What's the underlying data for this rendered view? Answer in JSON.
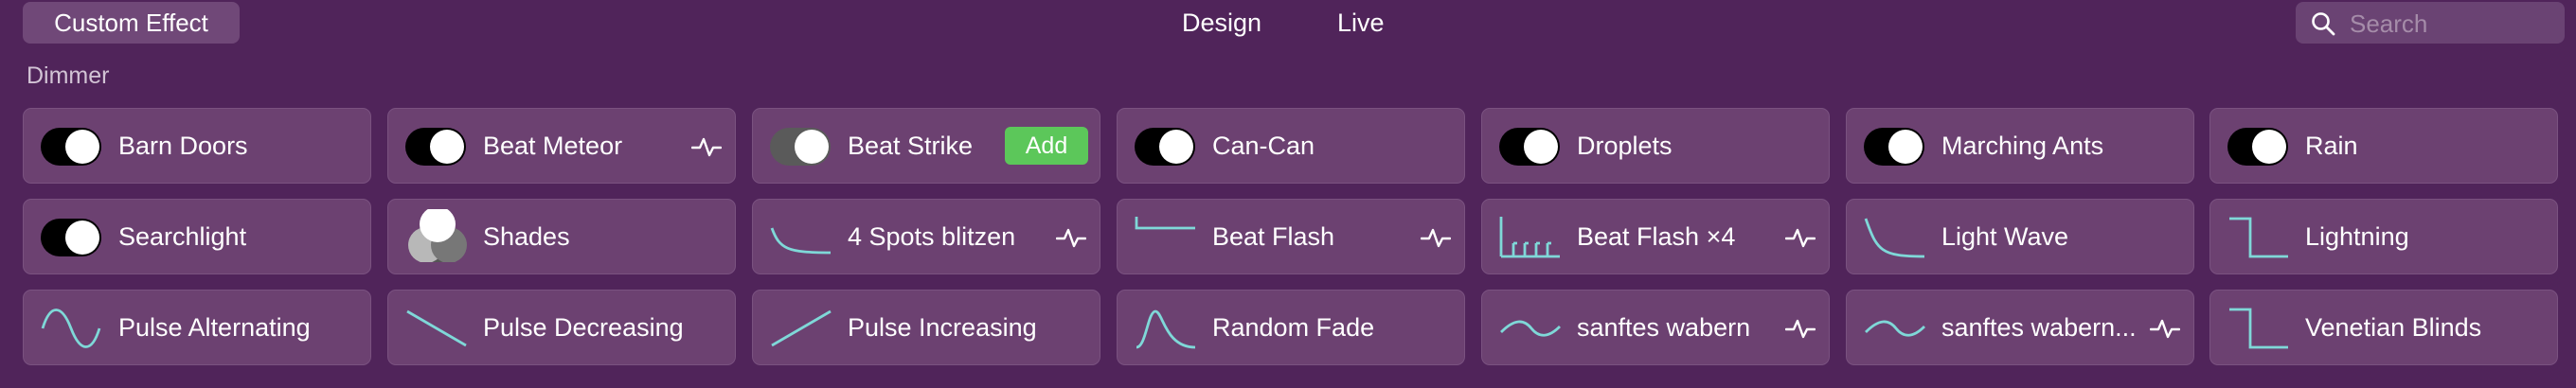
{
  "toolbar": {
    "custom_effect_label": "Custom Effect",
    "design_label": "Design",
    "live_label": "Live",
    "search_placeholder": "Search"
  },
  "section": {
    "title": "Dimmer"
  },
  "accent_color": "#7fd8d8",
  "add_button_color": "#5cc75a",
  "cards": [
    {
      "label": "Barn Doors",
      "icon": "toggle-icon",
      "pulse": false
    },
    {
      "label": "Beat Meteor",
      "icon": "toggle-icon",
      "pulse": true
    },
    {
      "label": "Beat Strike",
      "icon": "toggle-dim-icon",
      "pulse": false,
      "add_label": "Add"
    },
    {
      "label": "Can-Can",
      "icon": "toggle-icon",
      "pulse": false
    },
    {
      "label": "Droplets",
      "icon": "toggle-icon",
      "pulse": false
    },
    {
      "label": "Marching Ants",
      "icon": "toggle-icon",
      "pulse": false
    },
    {
      "label": "Rain",
      "icon": "toggle-icon",
      "pulse": false
    },
    {
      "label": "Searchlight",
      "icon": "toggle-icon",
      "pulse": false
    },
    {
      "label": "Shades",
      "icon": "shades-icon",
      "pulse": false
    },
    {
      "label": "4 Spots blitzen",
      "icon": "decay-curve-icon",
      "pulse": true
    },
    {
      "label": "Beat Flash",
      "icon": "flash-step-icon",
      "pulse": true
    },
    {
      "label": "Beat Flash ×4",
      "icon": "flash-bars-icon",
      "pulse": true
    },
    {
      "label": "Light Wave",
      "icon": "light-wave-icon",
      "pulse": false
    },
    {
      "label": "Lightning",
      "icon": "step-down-icon",
      "pulse": false
    },
    {
      "label": "Pulse Alternating",
      "icon": "sine-wave-icon",
      "pulse": false
    },
    {
      "label": "Pulse Decreasing",
      "icon": "ramp-down-icon",
      "pulse": false
    },
    {
      "label": "Pulse Increasing",
      "icon": "ramp-up-icon",
      "pulse": false
    },
    {
      "label": "Random Fade",
      "icon": "peak-icon",
      "pulse": false
    },
    {
      "label": "sanftes wabern",
      "icon": "gentle-wave-icon",
      "pulse": true
    },
    {
      "label": "sanftes wabern...",
      "icon": "gentle-wave-icon",
      "pulse": true
    },
    {
      "label": "Venetian Blinds",
      "icon": "step-down-icon",
      "pulse": false
    }
  ]
}
